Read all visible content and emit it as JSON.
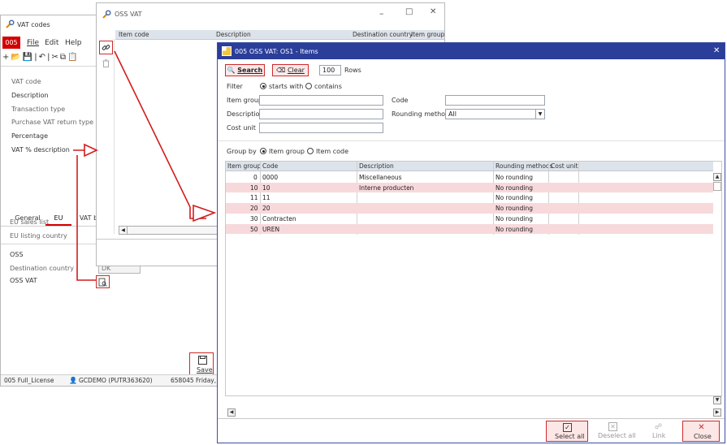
{
  "vat_window": {
    "title": "VAT codes",
    "company_badge": "005",
    "menu": [
      "File",
      "Edit",
      "Help"
    ],
    "fields": [
      "VAT code",
      "Description",
      "Transaction type",
      "Purchase VAT return type",
      "Percentage",
      "VAT % description"
    ],
    "tabs": [
      "General",
      "EU",
      "VAT b"
    ],
    "eu_fields": [
      "EU sales list",
      "EU listing country"
    ],
    "oss_section": "OSS",
    "destination_country_label": "Destination country",
    "destination_country_value": "DK",
    "oss_vat_label": "OSS VAT",
    "save_label": "Save",
    "status": [
      "005 Full_License",
      "GCDEMO (PUTR363620)",
      "658045",
      "Friday,"
    ]
  },
  "oss_window": {
    "title": "OSS VAT",
    "columns": [
      "Item code",
      "Description",
      "Destination country",
      "Item group"
    ]
  },
  "items_window": {
    "title": "005 OSS VAT: OS1 - Items",
    "search_label": "Search",
    "clear_label": "Clear",
    "rows_value": "100",
    "rows_label": "Rows",
    "filter_label": "Filter",
    "filter_starts_with": "starts with",
    "filter_contains": "contains",
    "item_group_label": "Item group",
    "description_label": "Description",
    "cost_unit_label": "Cost unit",
    "code_label": "Code",
    "rounding_label": "Rounding methods",
    "rounding_value": "All",
    "group_by_label": "Group by",
    "group_item_group": "Item group",
    "group_item_code": "Item code",
    "columns": [
      "Item group",
      "Code",
      "Description",
      "Rounding methods",
      "Cost unit"
    ],
    "rows": [
      {
        "group": "0",
        "code": "0000",
        "description": "Miscellaneous",
        "rounding": "No rounding"
      },
      {
        "group": "10",
        "code": "10",
        "description": "Interne producten",
        "rounding": "No rounding"
      },
      {
        "group": "11",
        "code": "11",
        "description": "",
        "rounding": "No rounding"
      },
      {
        "group": "20",
        "code": "20",
        "description": "",
        "rounding": "No rounding"
      },
      {
        "group": "30",
        "code": "Contracten",
        "description": "",
        "rounding": "No rounding"
      },
      {
        "group": "50",
        "code": "UREN",
        "description": "",
        "rounding": "No rounding"
      }
    ],
    "buttons": {
      "select_all": "Select all",
      "deselect_all": "Deselect all",
      "link": "Link",
      "close": "Close"
    }
  },
  "colors": {
    "accent_red": "#cc2b2b",
    "title_blue": "#2b3e99",
    "row_pink": "#f7d9dc"
  }
}
